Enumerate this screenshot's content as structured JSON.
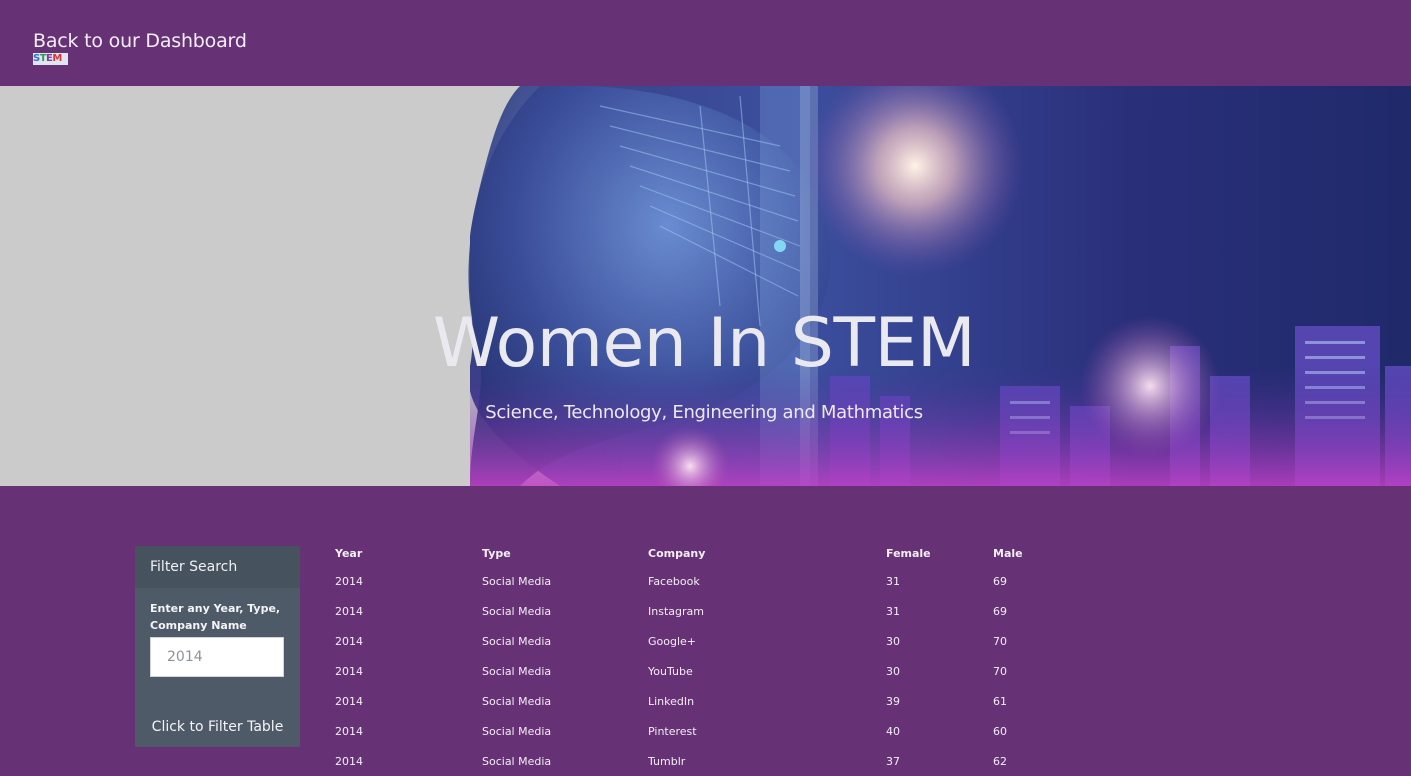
{
  "nav": {
    "back_link": "Back to our Dashboard",
    "logo_letters": [
      "S",
      "T",
      "E",
      "M"
    ]
  },
  "hero": {
    "title": "Women In STEM",
    "subtitle": "Science, Technology, Engineering and Mathmatics"
  },
  "filter": {
    "heading": "Filter Search",
    "label": "Enter any Year, Type, Company Name",
    "placeholder": "2014",
    "button": "Click to Filter Table"
  },
  "table": {
    "headers": [
      "Year",
      "Type",
      "Company",
      "Female",
      "Male"
    ],
    "rows": [
      [
        "2014",
        "Social Media",
        "Facebook",
        "31",
        "69"
      ],
      [
        "2014",
        "Social Media",
        "Instagram",
        "31",
        "69"
      ],
      [
        "2014",
        "Social Media",
        "Google+",
        "30",
        "70"
      ],
      [
        "2014",
        "Social Media",
        "YouTube",
        "30",
        "70"
      ],
      [
        "2014",
        "Social Media",
        "LinkedIn",
        "39",
        "61"
      ],
      [
        "2014",
        "Social Media",
        "Pinterest",
        "40",
        "60"
      ],
      [
        "2014",
        "Social Media",
        "Tumblr",
        "37",
        "62"
      ]
    ]
  },
  "colors": {
    "background": "#663275",
    "panel": "#4e5a68",
    "panel_header": "#46525e"
  }
}
